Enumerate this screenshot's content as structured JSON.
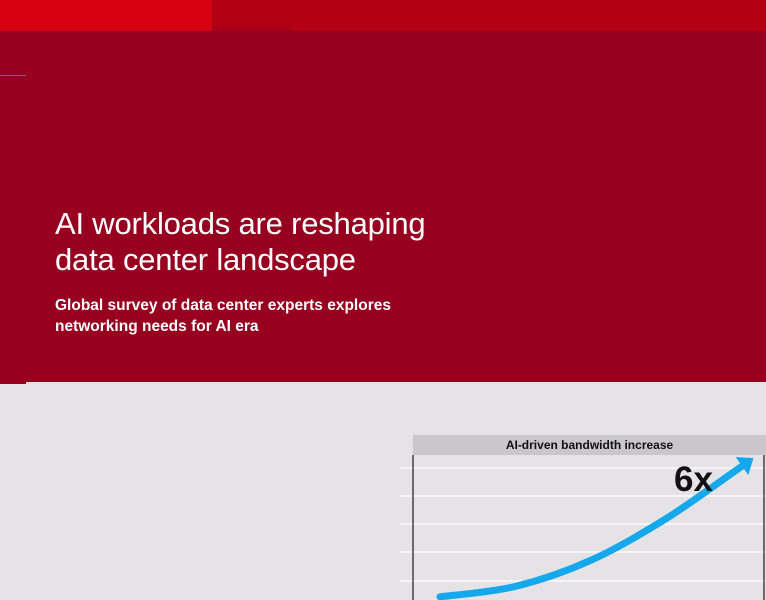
{
  "hero": {
    "title": "AI workloads are reshaping\ndata center landscape",
    "subtitle": "Global survey of data center experts explores\nnetworking needs for AI era"
  },
  "chart_data": {
    "type": "line",
    "title": "AI-driven bandwidth increase",
    "annotation": "6x",
    "series": [
      {
        "values": [
          1,
          1.4,
          2.4,
          4.0,
          6.0
        ]
      }
    ],
    "ylim": [
      0,
      6.5
    ],
    "grid": true,
    "legend": "none"
  },
  "colors": {
    "hero_bg": "#97001e",
    "top_band": "#b40013",
    "top_band_bright": "#d70010",
    "page_bg": "#e5e3e6",
    "curve": "#16a8ec"
  }
}
